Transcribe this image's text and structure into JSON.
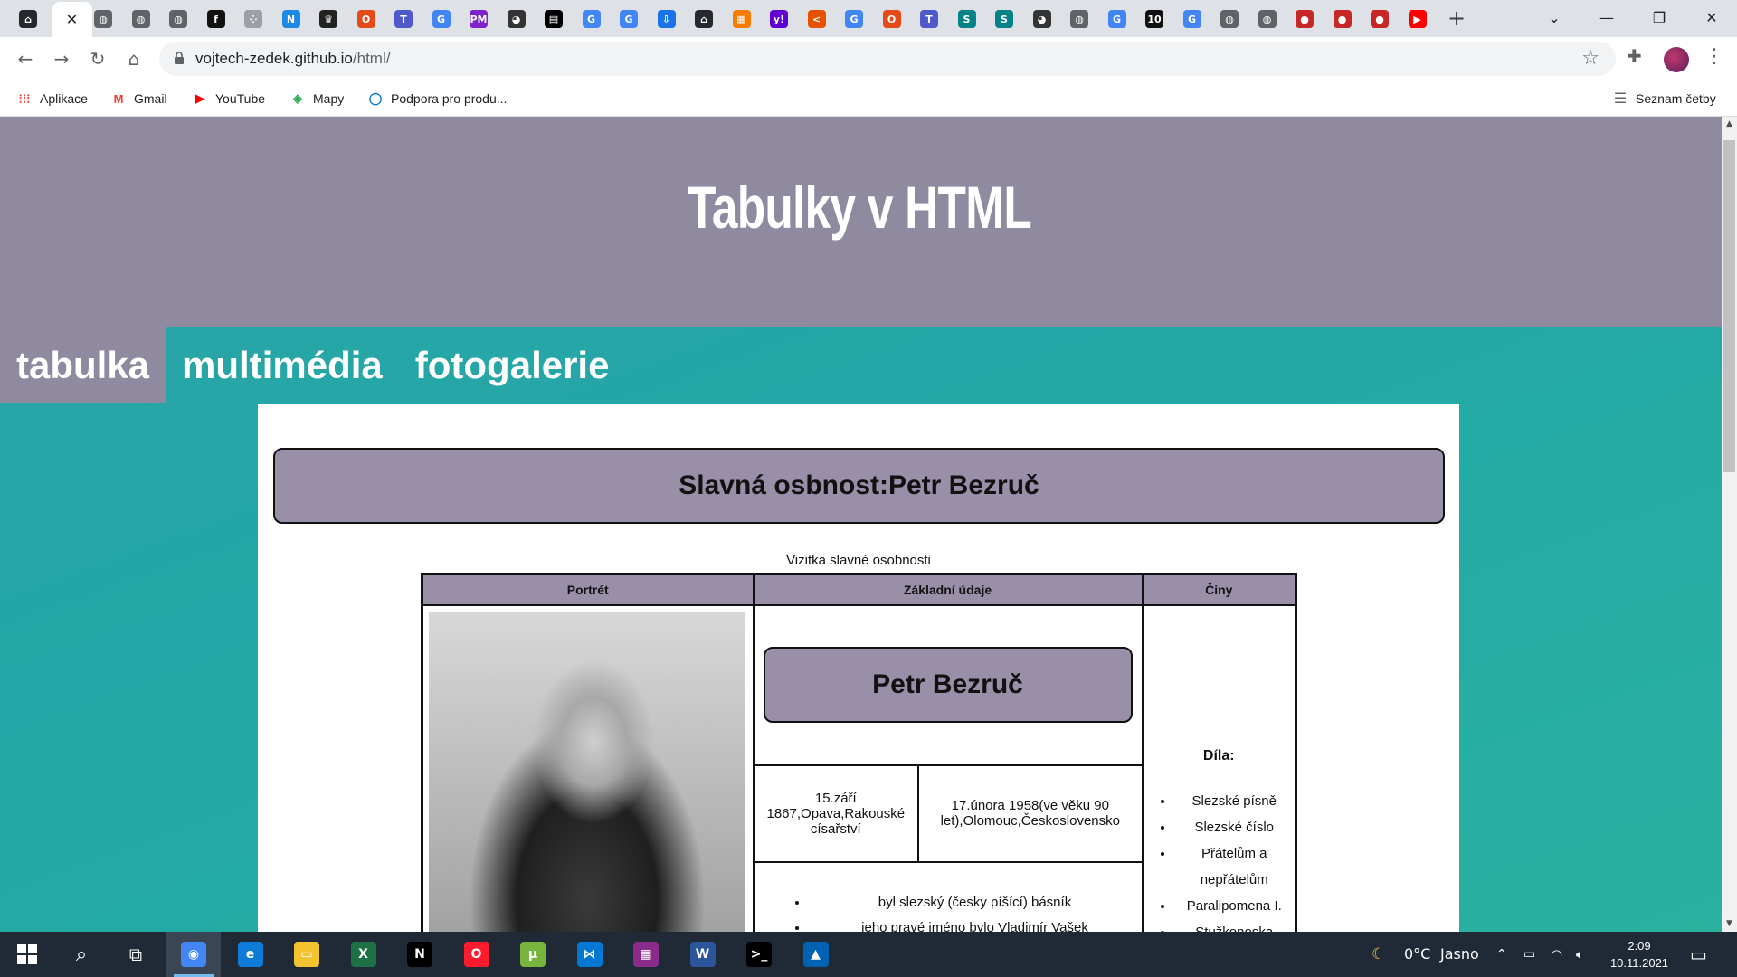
{
  "browser": {
    "tabs": [
      {
        "icon": "github-icon",
        "glyph": "⌂",
        "bg": "#24292e"
      },
      {
        "icon": "close-tab-icon",
        "glyph": "✕",
        "bg": "#ffffff",
        "active": true
      },
      {
        "icon": "globe-icon",
        "glyph": "◍",
        "bg": "#5f6368"
      },
      {
        "icon": "globe-icon",
        "glyph": "◍",
        "bg": "#5f6368"
      },
      {
        "icon": "globe-icon",
        "glyph": "◍",
        "bg": "#5f6368"
      },
      {
        "icon": "f-icon",
        "glyph": "f",
        "bg": "#111111"
      },
      {
        "icon": "dots-icon",
        "glyph": "⁘",
        "bg": "#9aa0a6"
      },
      {
        "icon": "n-icon",
        "glyph": "N",
        "bg": "#1e88e5"
      },
      {
        "icon": "crown-icon",
        "glyph": "♛",
        "bg": "#222222"
      },
      {
        "icon": "office-icon",
        "glyph": "O",
        "bg": "#e64a19"
      },
      {
        "icon": "teams-icon",
        "glyph": "T",
        "bg": "#5059c9"
      },
      {
        "icon": "google-icon",
        "glyph": "G",
        "bg": "#4285f4"
      },
      {
        "icon": "pm-icon",
        "glyph": "PM",
        "bg": "#7e22ce"
      },
      {
        "icon": "panda-icon",
        "glyph": "◕",
        "bg": "#333333"
      },
      {
        "icon": "film-icon",
        "glyph": "▤",
        "bg": "#000000"
      },
      {
        "icon": "google-icon",
        "glyph": "G",
        "bg": "#4285f4"
      },
      {
        "icon": "google-icon",
        "glyph": "G",
        "bg": "#4285f4"
      },
      {
        "icon": "download-icon",
        "glyph": "⇩",
        "bg": "#1a73e8"
      },
      {
        "icon": "github-icon",
        "glyph": "⌂",
        "bg": "#24292e"
      },
      {
        "icon": "grid-icon",
        "glyph": "▦",
        "bg": "#f57c00"
      },
      {
        "icon": "yahoo-icon",
        "glyph": "y!",
        "bg": "#6001d2"
      },
      {
        "icon": "arrow-icon",
        "glyph": "<",
        "bg": "#e65100"
      },
      {
        "icon": "google-icon",
        "glyph": "G",
        "bg": "#4285f4"
      },
      {
        "icon": "office-icon",
        "glyph": "O",
        "bg": "#e64a19"
      },
      {
        "icon": "teams-icon",
        "glyph": "T",
        "bg": "#5059c9"
      },
      {
        "icon": "sharepoint-icon",
        "glyph": "S",
        "bg": "#038387"
      },
      {
        "icon": "sharepoint-icon",
        "glyph": "S",
        "bg": "#038387"
      },
      {
        "icon": "panda-icon",
        "glyph": "◕",
        "bg": "#333333"
      },
      {
        "icon": "globe-icon",
        "glyph": "◍",
        "bg": "#5f6368"
      },
      {
        "icon": "google-icon",
        "glyph": "G",
        "bg": "#4285f4"
      },
      {
        "icon": "ten-icon",
        "glyph": "10",
        "bg": "#111111"
      },
      {
        "icon": "google-icon",
        "glyph": "G",
        "bg": "#4285f4"
      },
      {
        "icon": "globe-icon",
        "glyph": "◍",
        "bg": "#5f6368"
      },
      {
        "icon": "globe-icon",
        "glyph": "◍",
        "bg": "#5f6368"
      },
      {
        "icon": "red-icon",
        "glyph": "●",
        "bg": "#c62828"
      },
      {
        "icon": "red-icon",
        "glyph": "●",
        "bg": "#c62828"
      },
      {
        "icon": "red-icon",
        "glyph": "●",
        "bg": "#c62828"
      },
      {
        "icon": "youtube-icon",
        "glyph": "▶",
        "bg": "#ff0000"
      }
    ],
    "url_host": "vojtech-zedek.github.io",
    "url_path": "/html/",
    "bookmarks": [
      {
        "label": "Aplikace",
        "icon": "apps-grid-icon",
        "glyph": "⁞⁞⁞",
        "color": "#ea4335"
      },
      {
        "label": "Gmail",
        "icon": "gmail-icon",
        "glyph": "M",
        "color": "#ea4335"
      },
      {
        "label": "YouTube",
        "icon": "youtube-icon",
        "glyph": "▶",
        "color": "#ff0000"
      },
      {
        "label": "Mapy",
        "icon": "maps-icon",
        "glyph": "◈",
        "color": "#34a853"
      },
      {
        "label": "Podpora pro produ...",
        "icon": "dell-icon",
        "glyph": "◯",
        "color": "#0076ce"
      }
    ],
    "reading_list": "Seznam četby"
  },
  "page": {
    "site_title": "Tabulky v HTML",
    "nav": [
      "tabulka",
      "multimédia",
      "fotogalerie"
    ],
    "banner": "Slavná osbnost:Petr Bezruč",
    "caption": "Vizitka slavné osobnosti",
    "table": {
      "headers": [
        "Portrét",
        "Základní údaje",
        "Činy"
      ],
      "name": "Petr Bezruč",
      "birth": "15.září 1867,Opava,Rakouské císařství",
      "death": "17.února 1958(ve věku 90 let),Olomouc,Československo",
      "facts": [
        "byl slezský (česky píšící) básník",
        "jeho pravé jméno bylo Vladimír Vašek"
      ],
      "works_title": "Díla:",
      "works": [
        "Slezské písně",
        "Slezské číslo",
        "Přátelům a nepřátelům",
        "Paralipomena I.",
        "Stužkonoska"
      ]
    }
  },
  "taskbar": {
    "apps": [
      {
        "icon": "chrome-icon",
        "glyph": "◉",
        "bg": "#4285f4",
        "active": true
      },
      {
        "icon": "edge-icon",
        "glyph": "e",
        "bg": "#0f7bd9"
      },
      {
        "icon": "explorer-icon",
        "glyph": "▭",
        "bg": "#f4c430"
      },
      {
        "icon": "excel-icon",
        "glyph": "X",
        "bg": "#1e7145"
      },
      {
        "icon": "netflix-icon",
        "glyph": "N",
        "bg": "#000000"
      },
      {
        "icon": "opera-icon",
        "glyph": "O",
        "bg": "#ff1b2d"
      },
      {
        "icon": "utorrent-icon",
        "glyph": "µ",
        "bg": "#78b53e"
      },
      {
        "icon": "vscode-icon",
        "glyph": "⋈",
        "bg": "#0078d4"
      },
      {
        "icon": "winrar-icon",
        "glyph": "▦",
        "bg": "#8b2b8b"
      },
      {
        "icon": "word-icon",
        "glyph": "W",
        "bg": "#2b579a"
      },
      {
        "icon": "terminal-icon",
        "glyph": ">_",
        "bg": "#000000"
      },
      {
        "icon": "photos-icon",
        "glyph": "▲",
        "bg": "#0063b1"
      }
    ],
    "weather_temp": "0°C",
    "weather_text": "Jasno",
    "time": "2:09",
    "date": "10.11.2021"
  }
}
